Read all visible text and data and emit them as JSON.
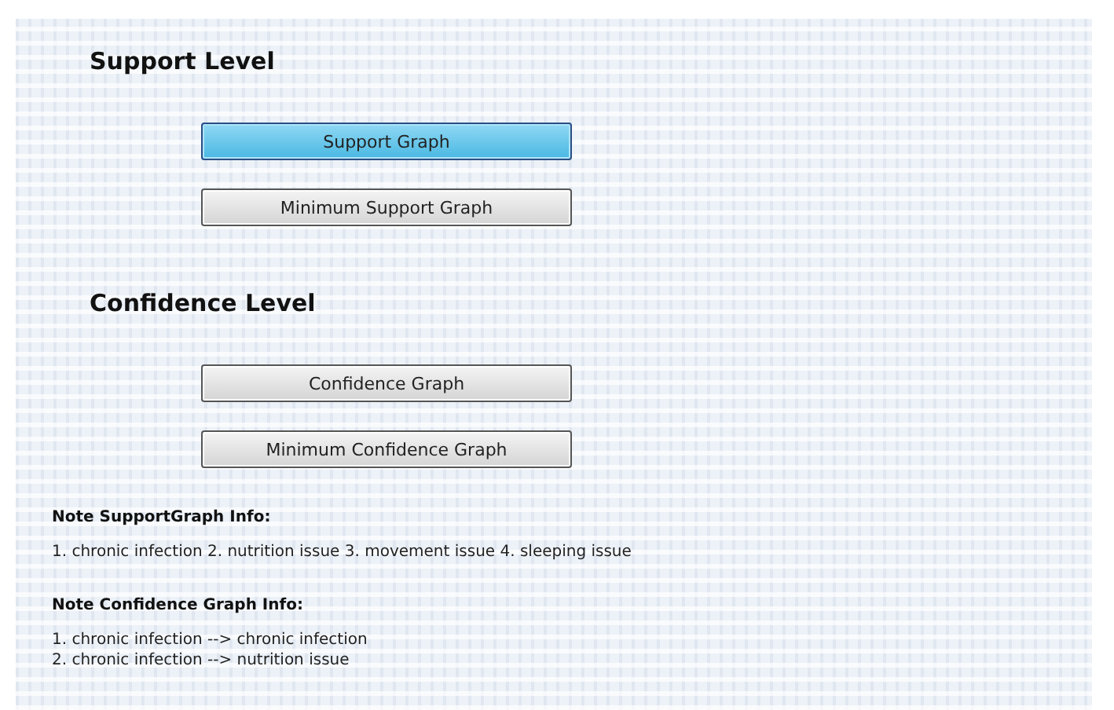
{
  "sections": [
    {
      "title": "Support Level",
      "buttons": [
        {
          "label": "Support Graph",
          "selected": true
        },
        {
          "label": "Minimum Support Graph",
          "selected": false
        }
      ]
    },
    {
      "title": "Confidence Level",
      "buttons": [
        {
          "label": "Confidence Graph",
          "selected": false
        },
        {
          "label": "Minimum Confidence Graph",
          "selected": false
        }
      ]
    }
  ],
  "notes": [
    {
      "title": "Note SupportGraph Info:",
      "lines": [
        "1. chronic infection 2. nutrition issue 3. movement issue 4. sleeping issue"
      ]
    },
    {
      "title": "Note Confidence Graph Info:",
      "lines": [
        "1. chronic infection --> chronic infection",
        "2. chronic infection --> nutrition issue"
      ]
    }
  ]
}
